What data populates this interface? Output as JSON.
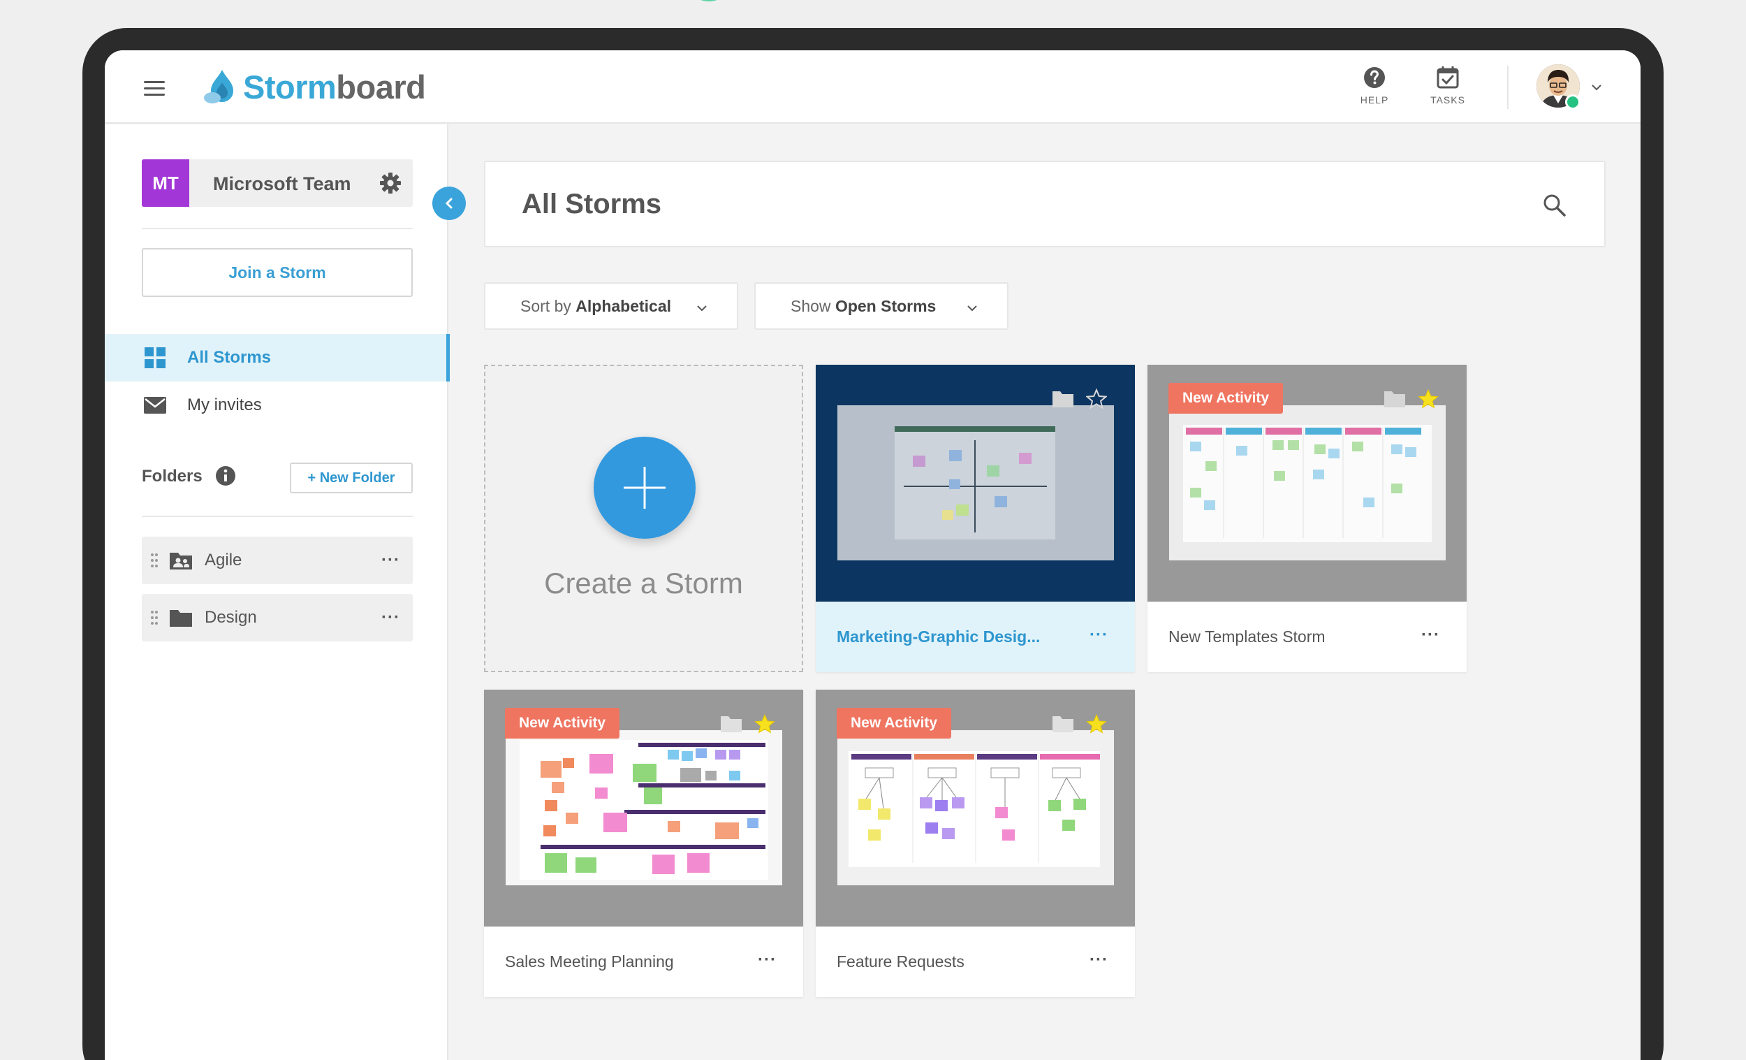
{
  "app": {
    "brand_part1": "Storm",
    "brand_part2": "board",
    "accent_color": "#3ba3db"
  },
  "header": {
    "menu_icon": "hamburger-icon",
    "help_label": "HELP",
    "tasks_label": "TASKS",
    "user_menu_icon": "chevron-down-icon"
  },
  "sidebar": {
    "team_initials": "MT",
    "team_name": "Microsoft Team",
    "team_color": "#a236d6",
    "join_label": "Join a Storm",
    "nav": [
      {
        "label": "All Storms",
        "icon": "grid-icon",
        "active": true
      },
      {
        "label": "My invites",
        "icon": "envelope-icon",
        "active": false
      }
    ],
    "folders_heading": "Folders",
    "new_folder_label": "+ New Folder",
    "folders": [
      {
        "name": "Agile",
        "icon": "shared-folder-icon"
      },
      {
        "name": "Design",
        "icon": "folder-icon"
      }
    ]
  },
  "main": {
    "title": "All Storms",
    "sort": {
      "prefix": "Sort by",
      "value": "Alphabetical"
    },
    "show": {
      "prefix": "Show",
      "value": "Open Storms"
    },
    "create_label": "Create a Storm",
    "new_activity_label": "New Activity",
    "storms": [
      {
        "name": "Marketing-Graphic Desig...",
        "new_activity": false,
        "starred": false,
        "selected": true
      },
      {
        "name": "New Templates Storm",
        "new_activity": true,
        "starred": true,
        "selected": false
      },
      {
        "name": "Sales Meeting Planning",
        "new_activity": true,
        "starred": true,
        "selected": false
      },
      {
        "name": "Feature Requests",
        "new_activity": true,
        "starred": true,
        "selected": false
      }
    ]
  }
}
